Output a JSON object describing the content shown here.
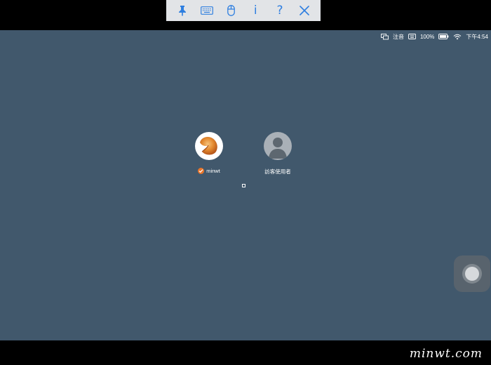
{
  "toolbar": {
    "items": [
      {
        "icon": "pin-icon"
      },
      {
        "icon": "keyboard-icon"
      },
      {
        "icon": "mouse-icon"
      },
      {
        "label": "i"
      },
      {
        "label": "?"
      },
      {
        "icon": "close-icon"
      }
    ],
    "accent_color": "#2f7fe0"
  },
  "menubar": {
    "input_method": "注音",
    "battery": "100%",
    "clock": "下午4:54"
  },
  "users": [
    {
      "name": "minwt",
      "avatar_icon": "fortune-cookie-icon",
      "logged_in": true
    },
    {
      "name": "訪客使用者",
      "avatar_icon": "guest-silhouette-icon",
      "logged_in": false
    }
  ],
  "colors": {
    "desktop_background": "#41586c",
    "login_badge": "#e8762b"
  },
  "watermark": "minwt.com"
}
